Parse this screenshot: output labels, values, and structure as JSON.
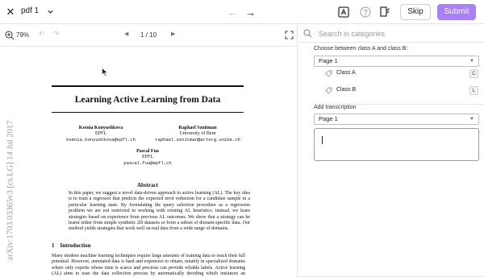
{
  "app": {
    "filename": "pdf 1",
    "skip_label": "Skip",
    "submit_label": "Submit",
    "accent_color": "#a980f5",
    "icons": [
      "close-icon",
      "chevron-down-icon",
      "arrow-left-icon",
      "arrow-right-icon",
      "text-box-icon",
      "help-icon",
      "document-edit-icon"
    ]
  },
  "pdf_toolbar": {
    "zoom": "79%",
    "page_indicator": "1 / 10",
    "icons": [
      "zoom-in-icon",
      "undo-icon",
      "redo-icon",
      "prev-page-icon",
      "next-page-icon",
      "fit-page-icon"
    ]
  },
  "document": {
    "title": "Learning Active Learning from Data",
    "authors": [
      {
        "name": "Ksenia Konyushkova",
        "affiliation": "EPFL",
        "email": "ksenia.konyushkova@epfl.ch"
      },
      {
        "name": "Raphael Sznitman",
        "affiliation": "University of Bern",
        "email": "raphael.sznitman@artorg.unibe.ch"
      },
      {
        "name": "Pascal Fua",
        "affiliation": "EPFL",
        "email": "pascal.fua@epfl.ch"
      }
    ],
    "abstract_heading": "Abstract",
    "abstract_text": "In this paper, we suggest a novel data-driven approach to active learning (AL). The key idea is to train a regressor that predicts the expected error reduction for a candidate sample in a particular learning state. By formulating the query selection procedure as a regression problem we are not restricted to working with existing AL heuristics; instead, we learn strategies based on experience from previous AL outcomes. We show that a strategy can be learnt either from simple synthetic 2D datasets or from a subset of domain-specific data. Our method yields strategies that work well on real data from a wide range of domains.",
    "section_number": "1",
    "section_title": "Introduction",
    "body_text": "Many modern machine learning techniques require large amounts of training data to reach their full potential. However, annotated data is hard and expensive to obtain, notably in specialized domains where only experts whose time is scarce and precious can provide reliable labels. Active learning (AL) aims to ease the data collection process by automatically deciding which instances an annotator",
    "arxiv_stamp": "arXiv:1703.03365v3  [cs.LG]  14 Jul 2017"
  },
  "panel": {
    "search_placeholder": "Search in categories",
    "classification": {
      "label": "Choose between class A and class B:",
      "page_select": "Page 1",
      "options": [
        {
          "label": "Class A",
          "key": "C"
        },
        {
          "label": "Class B",
          "key": "L"
        }
      ]
    },
    "transcription": {
      "label": "Add transcription",
      "page_select": "Page 1",
      "value": ""
    }
  }
}
